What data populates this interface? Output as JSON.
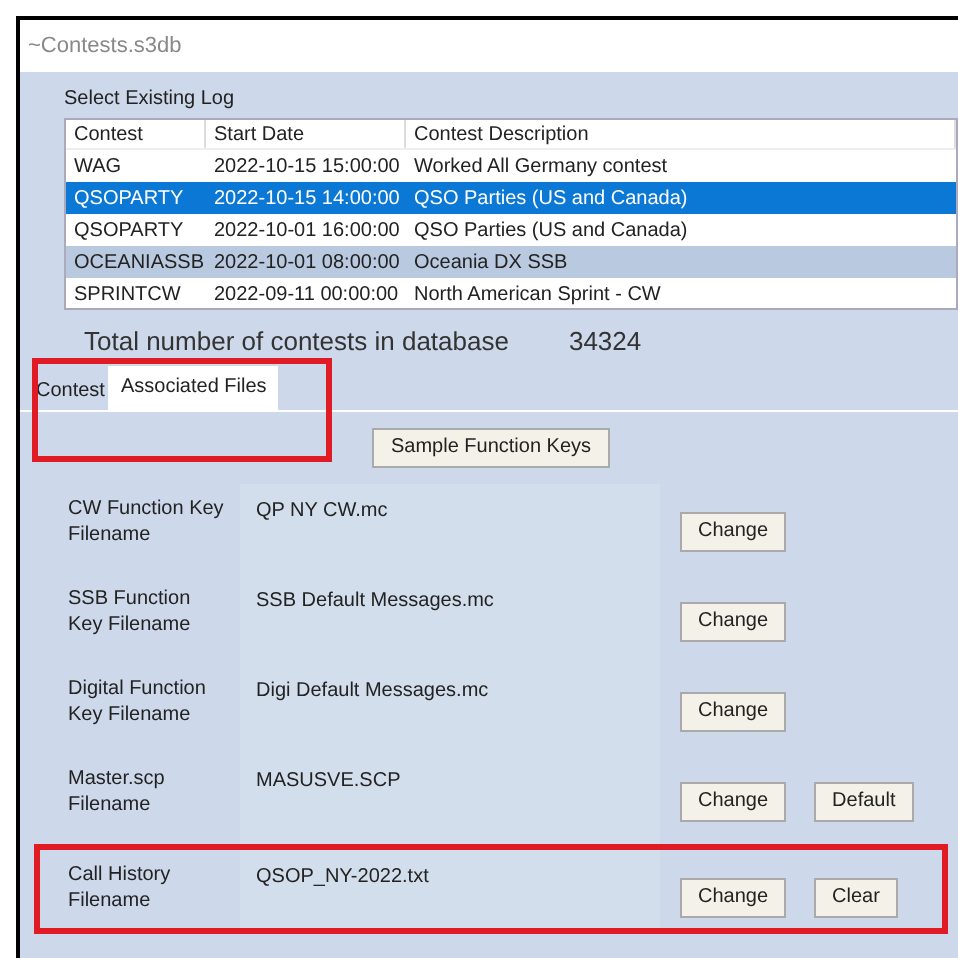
{
  "window": {
    "title": "~Contests.s3db"
  },
  "log_list": {
    "label": "Select Existing Log",
    "columns": [
      "Contest",
      "Start Date",
      "Contest Description"
    ],
    "rows": [
      {
        "cells": [
          "WAG",
          "2022-10-15 15:00:00",
          "Worked All Germany contest"
        ],
        "selected": false,
        "hovered": false
      },
      {
        "cells": [
          "QSOPARTY",
          "2022-10-15 14:00:00",
          "QSO Parties (US and Canada)"
        ],
        "selected": true,
        "hovered": false
      },
      {
        "cells": [
          "QSOPARTY",
          "2022-10-01 16:00:00",
          "QSO Parties (US and Canada)"
        ],
        "selected": false,
        "hovered": false
      },
      {
        "cells": [
          "OCEANIASSB",
          "2022-10-01 08:00:00",
          "Oceania DX SSB"
        ],
        "selected": false,
        "hovered": true
      },
      {
        "cells": [
          "SPRINTCW",
          "2022-09-11 00:00:00",
          "North American Sprint - CW"
        ],
        "selected": false,
        "hovered": false
      }
    ]
  },
  "total": {
    "label": "Total number of contests in database",
    "value": "34324"
  },
  "tabs": [
    {
      "label": "Contest",
      "selected": false
    },
    {
      "label": "Associated Files",
      "selected": true
    }
  ],
  "sample_button": "Sample Function Keys",
  "files": [
    {
      "label": "CW Function Key Filename",
      "value": "QP NY CW.mc",
      "buttons": [
        "Change"
      ],
      "highlighted": false
    },
    {
      "label": "SSB Function Key Filename",
      "value": "SSB Default Messages.mc",
      "buttons": [
        "Change"
      ],
      "highlighted": false
    },
    {
      "label": "Digital Function Key Filename",
      "value": "Digi Default Messages.mc",
      "buttons": [
        "Change"
      ],
      "highlighted": false
    },
    {
      "label": "Master.scp Filename",
      "value": "MASUSVE.SCP",
      "buttons": [
        "Change",
        "Default"
      ],
      "highlighted": false
    },
    {
      "label": "Call History Filename",
      "value": "QSOP_NY-2022.txt",
      "buttons": [
        "Change",
        "Clear"
      ],
      "highlighted": true
    }
  ]
}
